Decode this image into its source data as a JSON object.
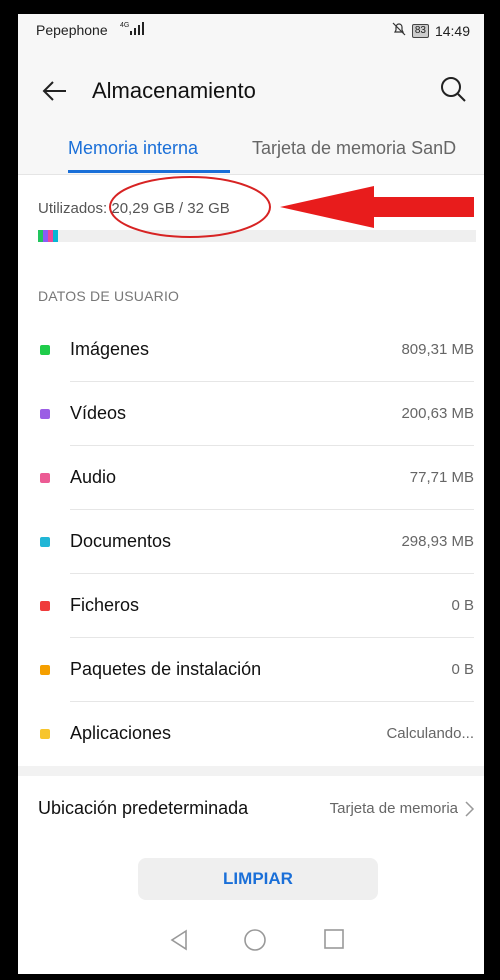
{
  "status_bar": {
    "carrier": "Pepephone",
    "network": "4G",
    "battery": "83",
    "time": "14:49"
  },
  "header": {
    "title": "Almacenamiento",
    "back_icon": "arrow-left-icon",
    "search_icon": "search-icon"
  },
  "tabs": [
    {
      "label": "Memoria interna",
      "active": true
    },
    {
      "label": "Tarjeta de memoria SanD",
      "active": false
    }
  ],
  "usage": {
    "label": "Utilizados:",
    "value": "20,29 GB / 32 GB",
    "used_fraction": 0.634,
    "segment_colors": [
      "#22c55e",
      "#8b5cf6",
      "#ec4899",
      "#06b6d4"
    ]
  },
  "annotation": {
    "circle_color": "#d72323",
    "arrow_color": "#e81c1c"
  },
  "section_title": "DATOS DE USUARIO",
  "categories": [
    {
      "name": "Imágenes",
      "size": "809,31 MB",
      "color": "#1fcc4a"
    },
    {
      "name": "Vídeos",
      "size": "200,63 MB",
      "color": "#9b5de5"
    },
    {
      "name": "Audio",
      "size": "77,71 MB",
      "color": "#ec5b94"
    },
    {
      "name": "Documentos",
      "size": "298,93 MB",
      "color": "#21b6d6"
    },
    {
      "name": "Ficheros",
      "size": "0 B",
      "color": "#ef3b3b"
    },
    {
      "name": "Paquetes de instalación",
      "size": "0 B",
      "color": "#f59f00"
    },
    {
      "name": "Aplicaciones",
      "size": "Calculando...",
      "color": "#f7c52c"
    }
  ],
  "default_location": {
    "label": "Ubicación predeterminada",
    "value": "Tarjeta de memoria"
  },
  "clean_button": "LIMPIAR",
  "nav_icons": [
    "back-triangle-icon",
    "home-circle-icon",
    "recents-square-icon"
  ],
  "colors": {
    "accent": "#1a6fd8"
  }
}
